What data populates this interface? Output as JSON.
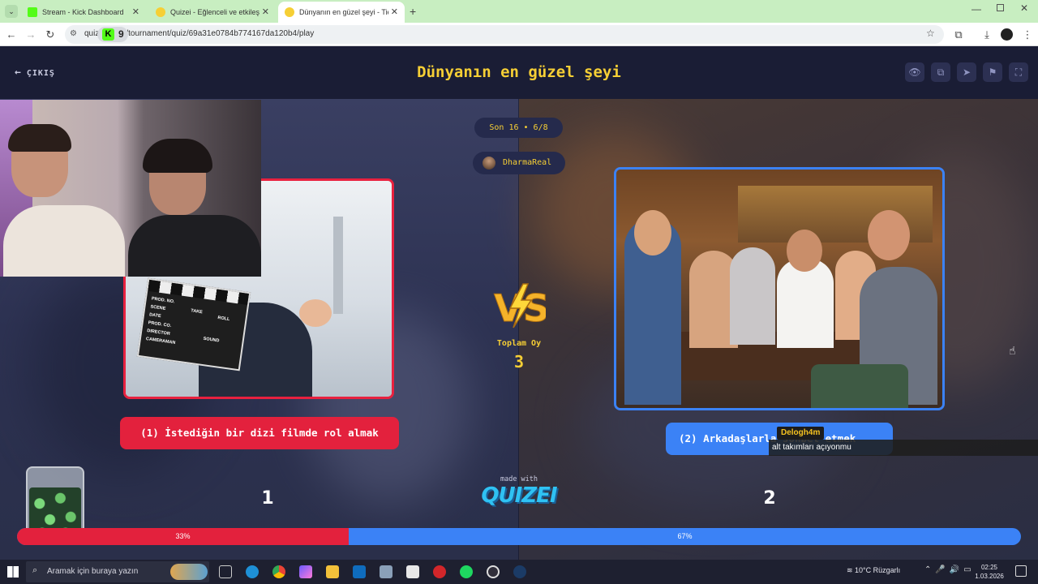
{
  "browser": {
    "tabs": [
      {
        "label": "Stream - Kick Dashboard",
        "favicon_color": "#53fc18"
      },
      {
        "label": "Quizei - Eğlenceli ve etkileşimli",
        "favicon_color": "#f6cf35"
      },
      {
        "label": "Dünyanın en güzel şeyi - Tier Li",
        "favicon_color": "#f6cf35"
      }
    ],
    "url_prefix": "quiz",
    "url": "/tournament/quiz/69a31e0784b774167da120b4/play",
    "kick_count": "9",
    "kick_letter": "K"
  },
  "header": {
    "exit_label": "ÇIKIŞ",
    "title": "Dünyanın en güzel şeyi",
    "buttons": [
      "eye-icon",
      "copy-icon",
      "send-icon",
      "flag-icon",
      "fullscreen-icon"
    ]
  },
  "match": {
    "round": "Son 16 • 6/8",
    "user": "DharmaReal",
    "total_label": "Toplam Oy",
    "total_votes": "3",
    "left": {
      "label": "(1) İstediğin bir dizi filmde rol almak",
      "count": "1",
      "percent": 33,
      "percent_label": "33%",
      "color": "#e3213d"
    },
    "right": {
      "label": "(2) Arkadaşlarla sohbet etmek",
      "count": "2",
      "percent": 67,
      "percent_label": "67%",
      "color": "#3b82f6"
    }
  },
  "branding": {
    "made_with": "made with",
    "logo": "QUIZEI"
  },
  "chat": {
    "username": "Delogh4m",
    "message": "alt takımları açıyonmu"
  },
  "clapper": {
    "row1": "PROD. NO.",
    "row1b": "SCENE",
    "take": "TAKE",
    "roll": "ROLL",
    "date": "DATE",
    "sound": "SOUND",
    "prodco": "PROD. CO.",
    "director": "DIRECTOR",
    "camera": "CAMERAMAN"
  },
  "taskbar": {
    "search_placeholder": "Aramak için buraya yazın",
    "weather": "10°C  Rüzgarlı",
    "time": "02:25",
    "date": "1.03.2026"
  }
}
